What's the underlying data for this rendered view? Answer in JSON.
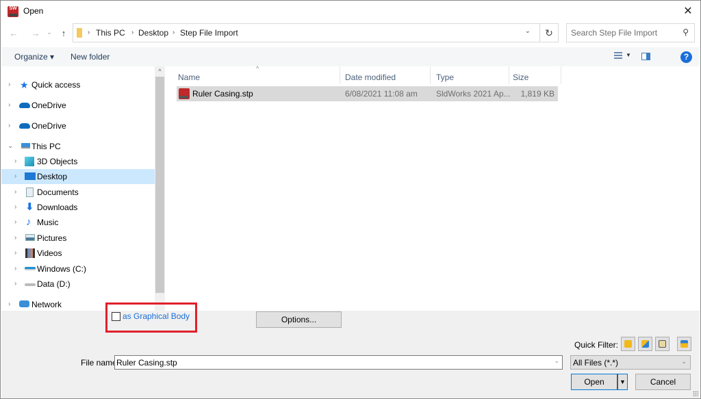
{
  "window": {
    "title": "Open",
    "close_symbol": "✕"
  },
  "nav": {
    "back_symbol": "←",
    "forward_symbol": "→",
    "recent_symbol": "⌄",
    "up_symbol": "↑",
    "breadcrumbs": [
      "This PC",
      "Desktop",
      "Step File Import"
    ],
    "separator": "›",
    "dropdown_symbol": "⌄",
    "refresh_symbol": "↻"
  },
  "search": {
    "placeholder": "Search Step File Import",
    "icon_symbol": "⚲"
  },
  "toolbar": {
    "organize_label": "Organize ▾",
    "new_folder_label": "New folder",
    "view_dropdown_symbol": "▼",
    "help_symbol": "?"
  },
  "sidebar": {
    "scroll_up_symbol": "^",
    "items": [
      {
        "label": "Quick access",
        "icon": "star-icon",
        "expanded": false,
        "level": 0
      },
      {
        "label": "OneDrive",
        "icon": "cloud-icon",
        "expanded": false,
        "level": 0
      },
      {
        "label": "OneDrive",
        "icon": "cloud-icon",
        "expanded": false,
        "level": 0
      },
      {
        "label": "This PC",
        "icon": "computer-icon",
        "expanded": true,
        "level": 0
      },
      {
        "label": "3D Objects",
        "icon": "cube-icon",
        "expanded": false,
        "level": 1
      },
      {
        "label": "Desktop",
        "icon": "desktop-icon",
        "expanded": false,
        "level": 1,
        "selected": true
      },
      {
        "label": "Documents",
        "icon": "document-icon",
        "expanded": false,
        "level": 1
      },
      {
        "label": "Downloads",
        "icon": "download-icon",
        "expanded": false,
        "level": 1
      },
      {
        "label": "Music",
        "icon": "music-icon",
        "expanded": false,
        "level": 1
      },
      {
        "label": "Pictures",
        "icon": "pictures-icon",
        "expanded": false,
        "level": 1
      },
      {
        "label": "Videos",
        "icon": "video-icon",
        "expanded": false,
        "level": 1
      },
      {
        "label": "Windows (C:)",
        "icon": "drive-c-icon",
        "expanded": false,
        "level": 1
      },
      {
        "label": "Data (D:)",
        "icon": "drive-icon",
        "expanded": false,
        "level": 1
      },
      {
        "label": "Network",
        "icon": "network-icon",
        "expanded": false,
        "level": 0
      }
    ],
    "chevron_collapsed": "›",
    "chevron_expanded": "⌄"
  },
  "filelist": {
    "columns": [
      "Name",
      "Date modified",
      "Type",
      "Size"
    ],
    "sort_indicator": "^",
    "rows": [
      {
        "name": "Ruler Casing.stp",
        "date_modified": "6/08/2021 11:08 am",
        "type": "SldWorks 2021 Ap...",
        "size": "1,819 KB",
        "selected": true
      }
    ]
  },
  "options": {
    "graphical_body_label": "as Graphical Body",
    "graphical_body_checked": false,
    "options_button_label": "Options...",
    "highlight_color": "#e0202a"
  },
  "quick_filter": {
    "label": "Quick Filter:",
    "buttons": [
      "filter-parts-icon",
      "filter-assemblies-icon",
      "filter-drawings-icon",
      "filter-top-level-assemblies-icon"
    ]
  },
  "footer": {
    "file_name_label": "File name:",
    "file_name_value": "Ruler Casing.stp",
    "file_type_value": "All Files (*.*)",
    "dropdown_symbol": "⌄",
    "open_label": "Open",
    "open_dropdown_symbol": "▼",
    "cancel_label": "Cancel"
  },
  "colors": {
    "accent": "#0078d7",
    "selection": "#cce8ff",
    "file_selection": "#d9d9d9",
    "link_blue": "#1a6ed8"
  }
}
